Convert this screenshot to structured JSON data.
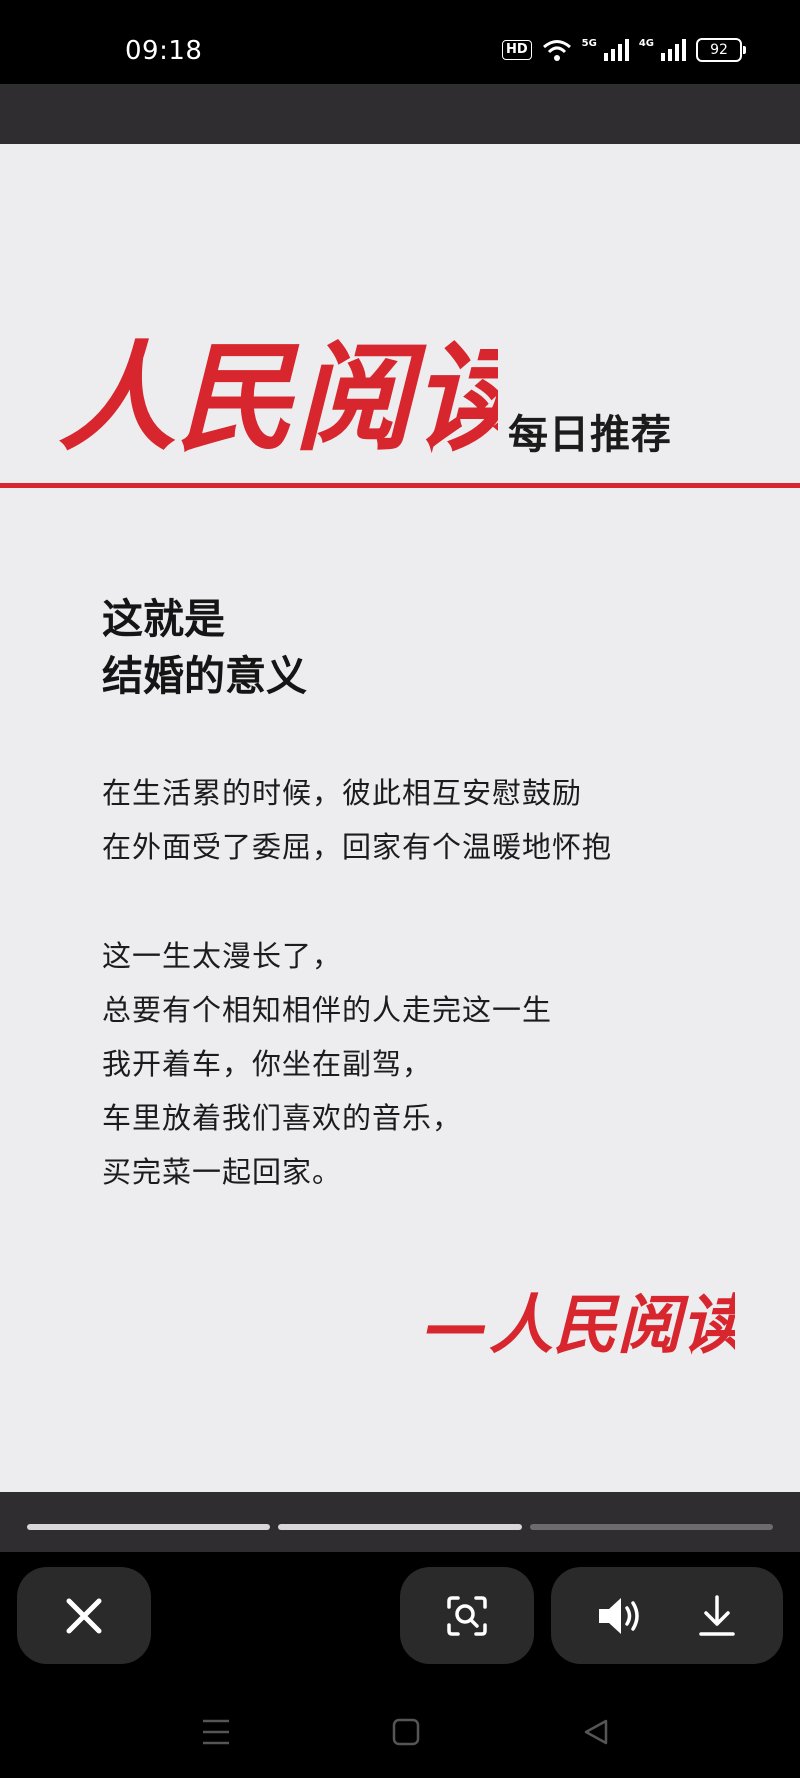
{
  "status_bar": {
    "time": "09:18",
    "hd_label": "HD",
    "net_5g": "5G",
    "net_4g": "4G",
    "battery": "92"
  },
  "poster": {
    "brand": "人民阅读",
    "brand_sub": "每日推荐",
    "title": "这就是\n结婚的意义",
    "paragraph_1": "在生活累的时候，彼此相互安慰鼓励\n在外面受了委屈，回家有个温暖地怀抱",
    "paragraph_2": "这一生太漫长了，\n总要有个相知相伴的人走完这一生\n我开着车，你坐在副驾，\n车里放着我们喜欢的音乐，\n买完菜一起回家。",
    "signature": "—人民阅读",
    "accent_color": "#d7262d"
  },
  "story_progress": {
    "segments": 3,
    "viewed": 2
  },
  "controls": {
    "close_icon": "close-icon",
    "lens_icon": "image-search-icon",
    "sound_icon": "speaker-icon",
    "download_icon": "download-icon"
  },
  "nav": {
    "recents_icon": "menu-icon",
    "home_icon": "home-icon",
    "back_icon": "back-icon"
  }
}
